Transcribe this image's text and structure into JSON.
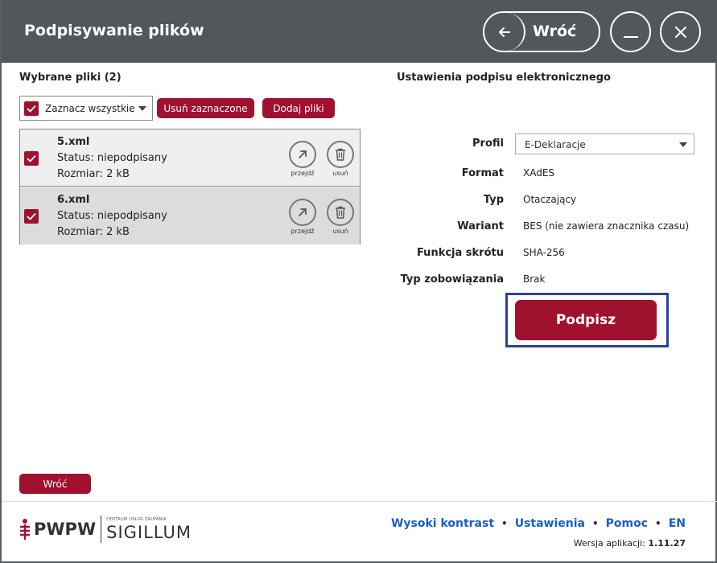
{
  "header": {
    "title": "Podpisywanie plików",
    "back_label": "Wróć"
  },
  "left": {
    "title": "Wybrane pliki  (2)",
    "select_all_label": "Zaznacz wszystkie",
    "remove_selected_label": "Usuń zaznaczone",
    "add_files_label": "Dodaj pliki",
    "files": [
      {
        "name": "5.xml",
        "status": "Status: niepodpisany",
        "size": "Rozmiar: 2 kB",
        "go_label": "przejdź",
        "delete_label": "usuń",
        "checked": true
      },
      {
        "name": "6.xml",
        "status": "Status: niepodpisany",
        "size": "Rozmiar: 2 kB",
        "go_label": "przejdź",
        "delete_label": "usuń",
        "checked": true
      }
    ],
    "back_button_label": "Wróć"
  },
  "right": {
    "title": "Ustawienia podpisu elektronicznego",
    "profile_label": "Profil",
    "profile_value": "E-Deklaracje",
    "format_label": "Format",
    "format_value": "XAdES",
    "type_label": "Typ",
    "type_value": "Otaczający",
    "variant_label": "Wariant",
    "variant_value": "BES (nie zawiera znacznika czasu)",
    "hash_label": "Funkcja skrótu",
    "hash_value": "SHA-256",
    "commitment_label": "Typ zobowiązania",
    "commitment_value": "Brak",
    "sign_button_label": "Podpisz"
  },
  "footer": {
    "logo_main": "PWPW",
    "logo_small": "CENTRUM USŁUG ZAUFANIA",
    "logo_sub": "SIGILLUM",
    "links": [
      "Wysoki kontrast",
      "Ustawienia",
      "Pomoc",
      "EN"
    ],
    "version_label": "Wersja aplikacji:",
    "version_value": "1.11.27"
  },
  "colors": {
    "accent": "#a0112e",
    "header_bg": "#53575b",
    "link": "#1a5fc2",
    "focus": "#2c3fa6"
  }
}
